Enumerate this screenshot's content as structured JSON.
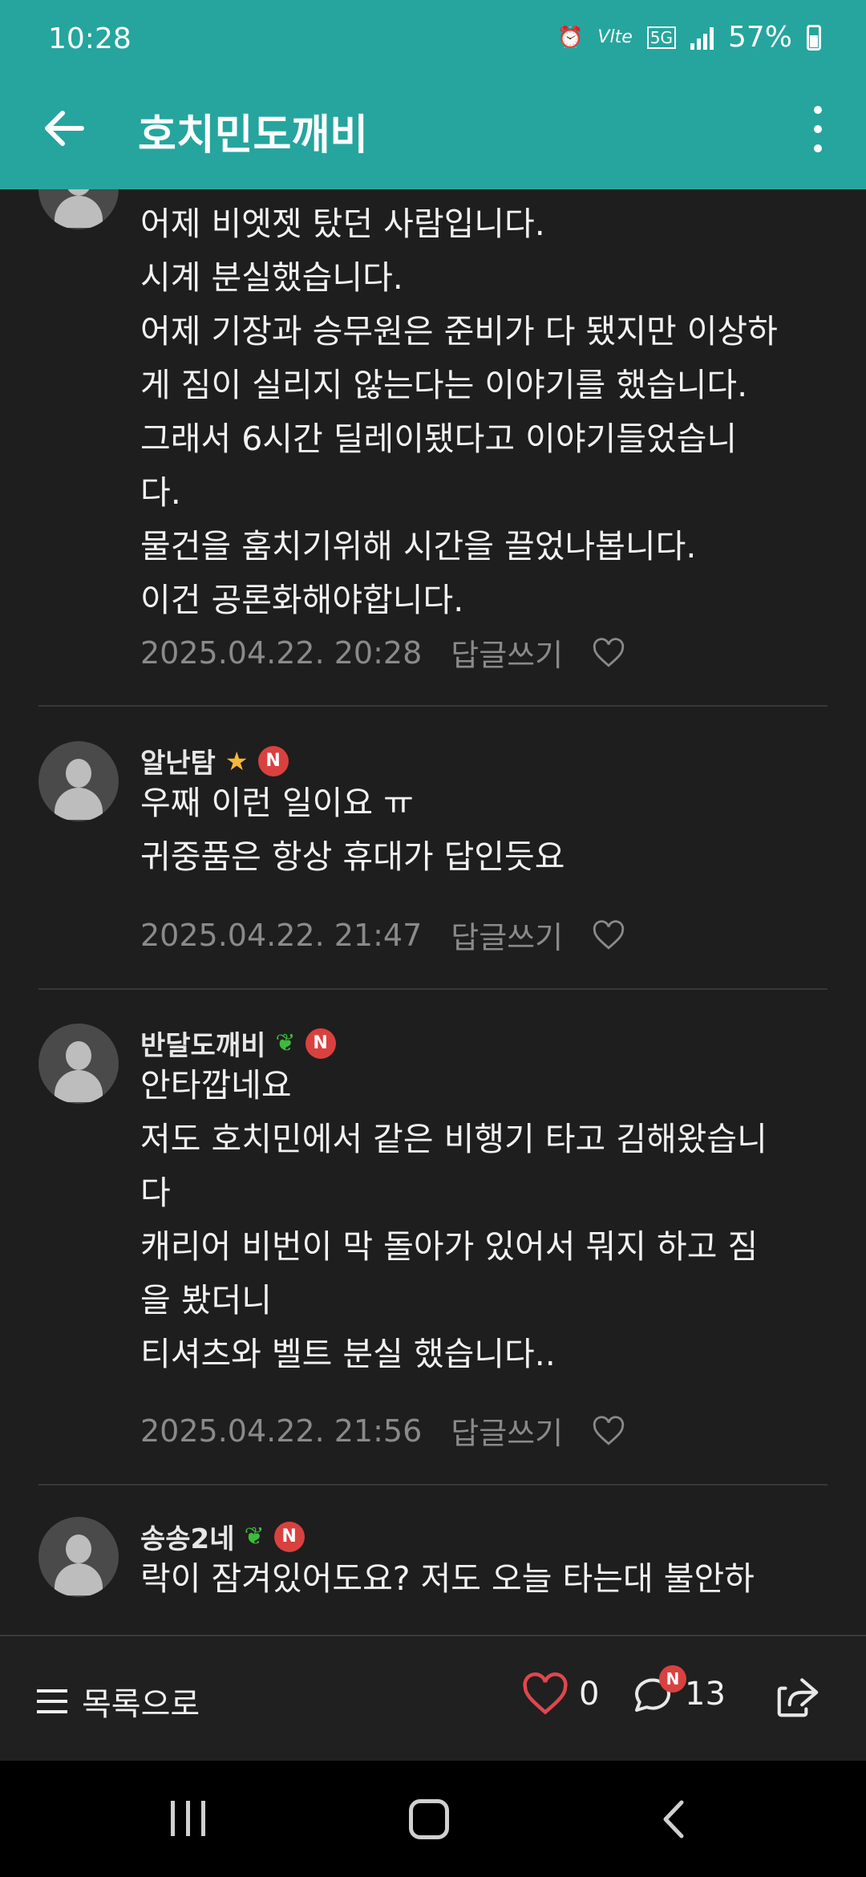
{
  "status_bar": {
    "time": "10:28",
    "network": "5G",
    "battery": "57%"
  },
  "app_bar": {
    "title": "호치민도깨비"
  },
  "comments": [
    {
      "author": "",
      "lines": [
        "어제 비엣젯 탔던 사람입니다.",
        "시계 분실했습니다.",
        "어제 기장과 승무원은 준비가 다 됐지만 이상하",
        "게 짐이 실리지 않는다는 이야기를 했습니다.",
        "그래서 6시간 딜레이됐다고 이야기들었습니",
        "다.",
        "물건을 훔치기위해 시간을 끌었나봅니다.",
        "이건 공론화해야합니다."
      ],
      "date": "2025.04.22. 20:28",
      "reply_label": "답글쓰기"
    },
    {
      "author": "알난탐",
      "grade_icon": "star",
      "badge": "N",
      "lines": [
        "우째 이런 일이요 ㅠ",
        "귀중품은 항상 휴대가 답인듯요"
      ],
      "date": "2025.04.22. 21:47",
      "reply_label": "답글쓰기"
    },
    {
      "author": "반달도깨비",
      "grade_icon": "sprout",
      "badge": "N",
      "lines": [
        "안타깝네요",
        "저도 호치민에서 같은 비행기 타고 김해왔습니",
        "다",
        "캐리어 비번이 막 돌아가 있어서 뭐지 하고 짐",
        "을 봤더니",
        "티셔츠와 벨트 분실 했습니다.."
      ],
      "date": "2025.04.22. 21:56",
      "reply_label": "답글쓰기"
    },
    {
      "author": "송송2네",
      "grade_icon": "sprout",
      "badge": "N",
      "lines": [
        "락이 잠겨있어도요? 저도 오늘 타는대 불안하"
      ],
      "date": "",
      "reply_label": ""
    }
  ],
  "bottom_bar": {
    "list_label": "목록으로",
    "like_count": "0",
    "comment_count": "13",
    "comment_badge": "N"
  },
  "colors": {
    "header": "#25a59e",
    "background": "#1e1e1e",
    "like": "#e0474c",
    "badge": "#d9413f"
  },
  "icons": [
    "back-arrow-icon",
    "more-vert-icon",
    "heart-icon",
    "comment-icon",
    "share-icon",
    "menu-icon"
  ]
}
